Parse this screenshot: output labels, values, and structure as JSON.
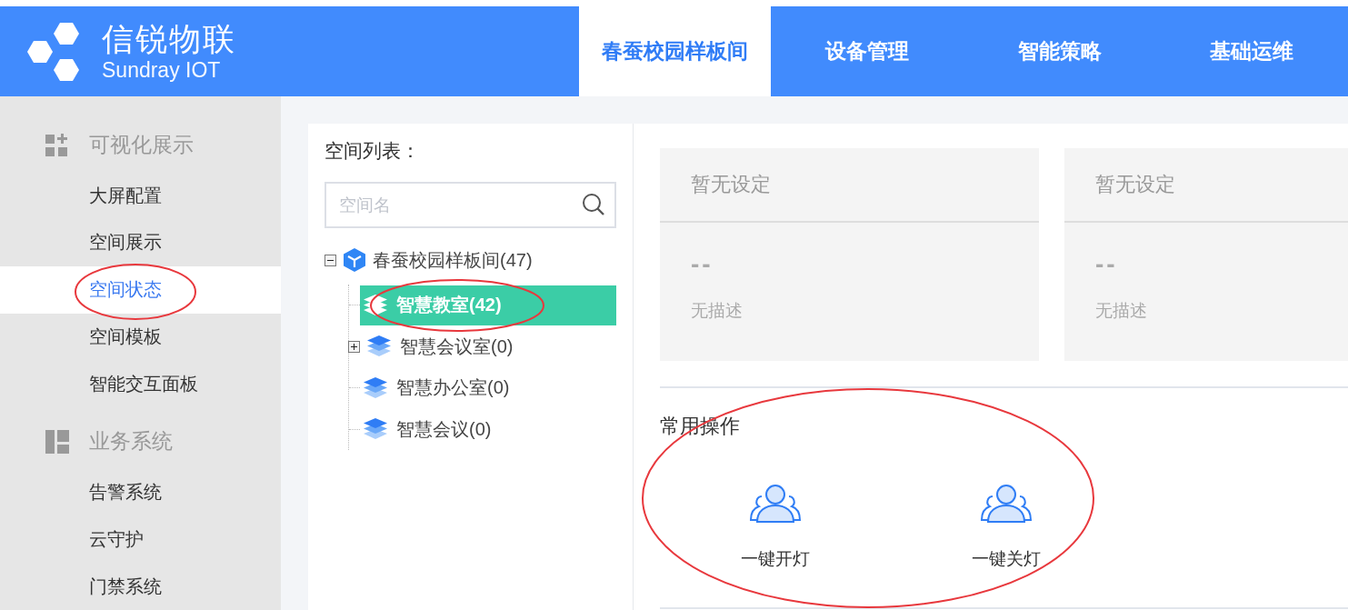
{
  "logo": {
    "name": "信锐物联",
    "subtitle": "Sundray IOT"
  },
  "nav_tabs": [
    {
      "label": "春蚕校园样板间",
      "selected": true
    },
    {
      "label": "设备管理",
      "selected": false
    },
    {
      "label": "智能策略",
      "selected": false
    },
    {
      "label": "基础运维",
      "selected": false
    }
  ],
  "sidebar": {
    "groups": [
      {
        "kind": "visual",
        "title": "可视化展示",
        "items": [
          {
            "label": "大屏配置",
            "selected": false
          },
          {
            "label": "空间展示",
            "selected": false
          },
          {
            "label": "空间状态",
            "selected": true
          },
          {
            "label": "空间模板",
            "selected": false
          },
          {
            "label": "智能交互面板",
            "selected": false
          }
        ]
      },
      {
        "kind": "business",
        "title": "业务系统",
        "items": [
          {
            "label": "告警系统",
            "selected": false
          },
          {
            "label": "云守护",
            "selected": false
          },
          {
            "label": "门禁系统",
            "selected": false
          }
        ]
      }
    ]
  },
  "space_list": {
    "title": "空间列表：",
    "search": {
      "placeholder": "空间名"
    },
    "tree": [
      {
        "label": "春蚕校园样板间(47)",
        "expanded": true,
        "children": [
          {
            "label": "智慧教室(42)",
            "selected": true,
            "kind": "leaf"
          },
          {
            "label": "智慧会议室(0)",
            "selected": false,
            "kind": "collapsed"
          },
          {
            "label": "智慧办公室(0)",
            "selected": false,
            "kind": "leaf"
          },
          {
            "label": "智慧会议(0)",
            "selected": false,
            "kind": "leaf"
          }
        ]
      }
    ]
  },
  "cards": [
    {
      "title": "暂无设定",
      "value": "--",
      "description": "无描述"
    },
    {
      "title": "暂无设定",
      "value": "--",
      "description": "无描述"
    }
  ],
  "common_actions": {
    "title": "常用操作",
    "actions": [
      {
        "label": "一键开灯"
      },
      {
        "label": "一键关灯"
      }
    ]
  }
}
